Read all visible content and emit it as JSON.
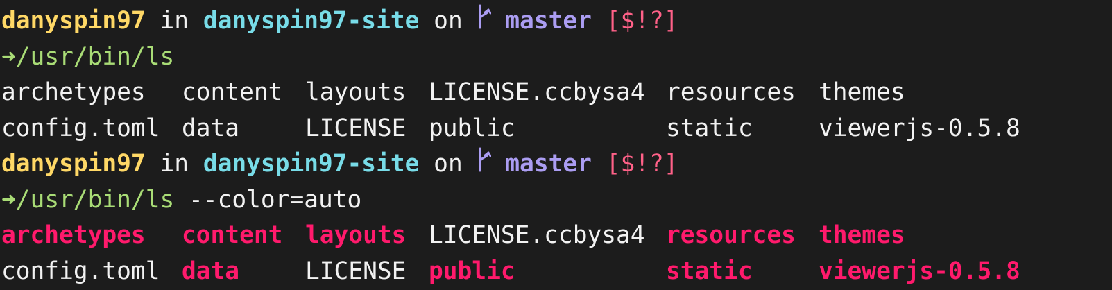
{
  "prompt": {
    "user": "danyspin97",
    "in_word": "in",
    "directory": "danyspin97-site",
    "on_word": "on",
    "branch": "master",
    "status": "[$!?]",
    "arrow_glyph": "➜"
  },
  "commands": [
    {
      "program": "/usr/bin/ls",
      "args": ""
    },
    {
      "program": "/usr/bin/ls",
      "args": "--color=auto"
    }
  ],
  "listing_plain": [
    [
      "archetypes",
      "content",
      "layouts",
      "LICENSE.ccbysa4",
      "resources",
      "themes"
    ],
    [
      "config.toml",
      "data",
      "LICENSE",
      "public",
      "static",
      "viewerjs-0.5.8"
    ]
  ],
  "listing_colored": [
    [
      "archetypes",
      "content",
      "layouts",
      "LICENSE.ccbysa4",
      "resources",
      "themes"
    ],
    [
      "config.toml",
      "data",
      "LICENSE",
      "public",
      "static",
      "viewerjs-0.5.8"
    ]
  ],
  "colors": {
    "background": "#1c1c1c",
    "foreground": "#f2f2f2",
    "user": "#ffd866",
    "directory_prompt": "#78dce8",
    "branch": "#ab9df2",
    "git_status": "#ff6188",
    "arrow_and_command": "#a9dc76",
    "ls_directory": "#ff1a6c"
  },
  "icons": {
    "branch": "git-branch-icon"
  }
}
